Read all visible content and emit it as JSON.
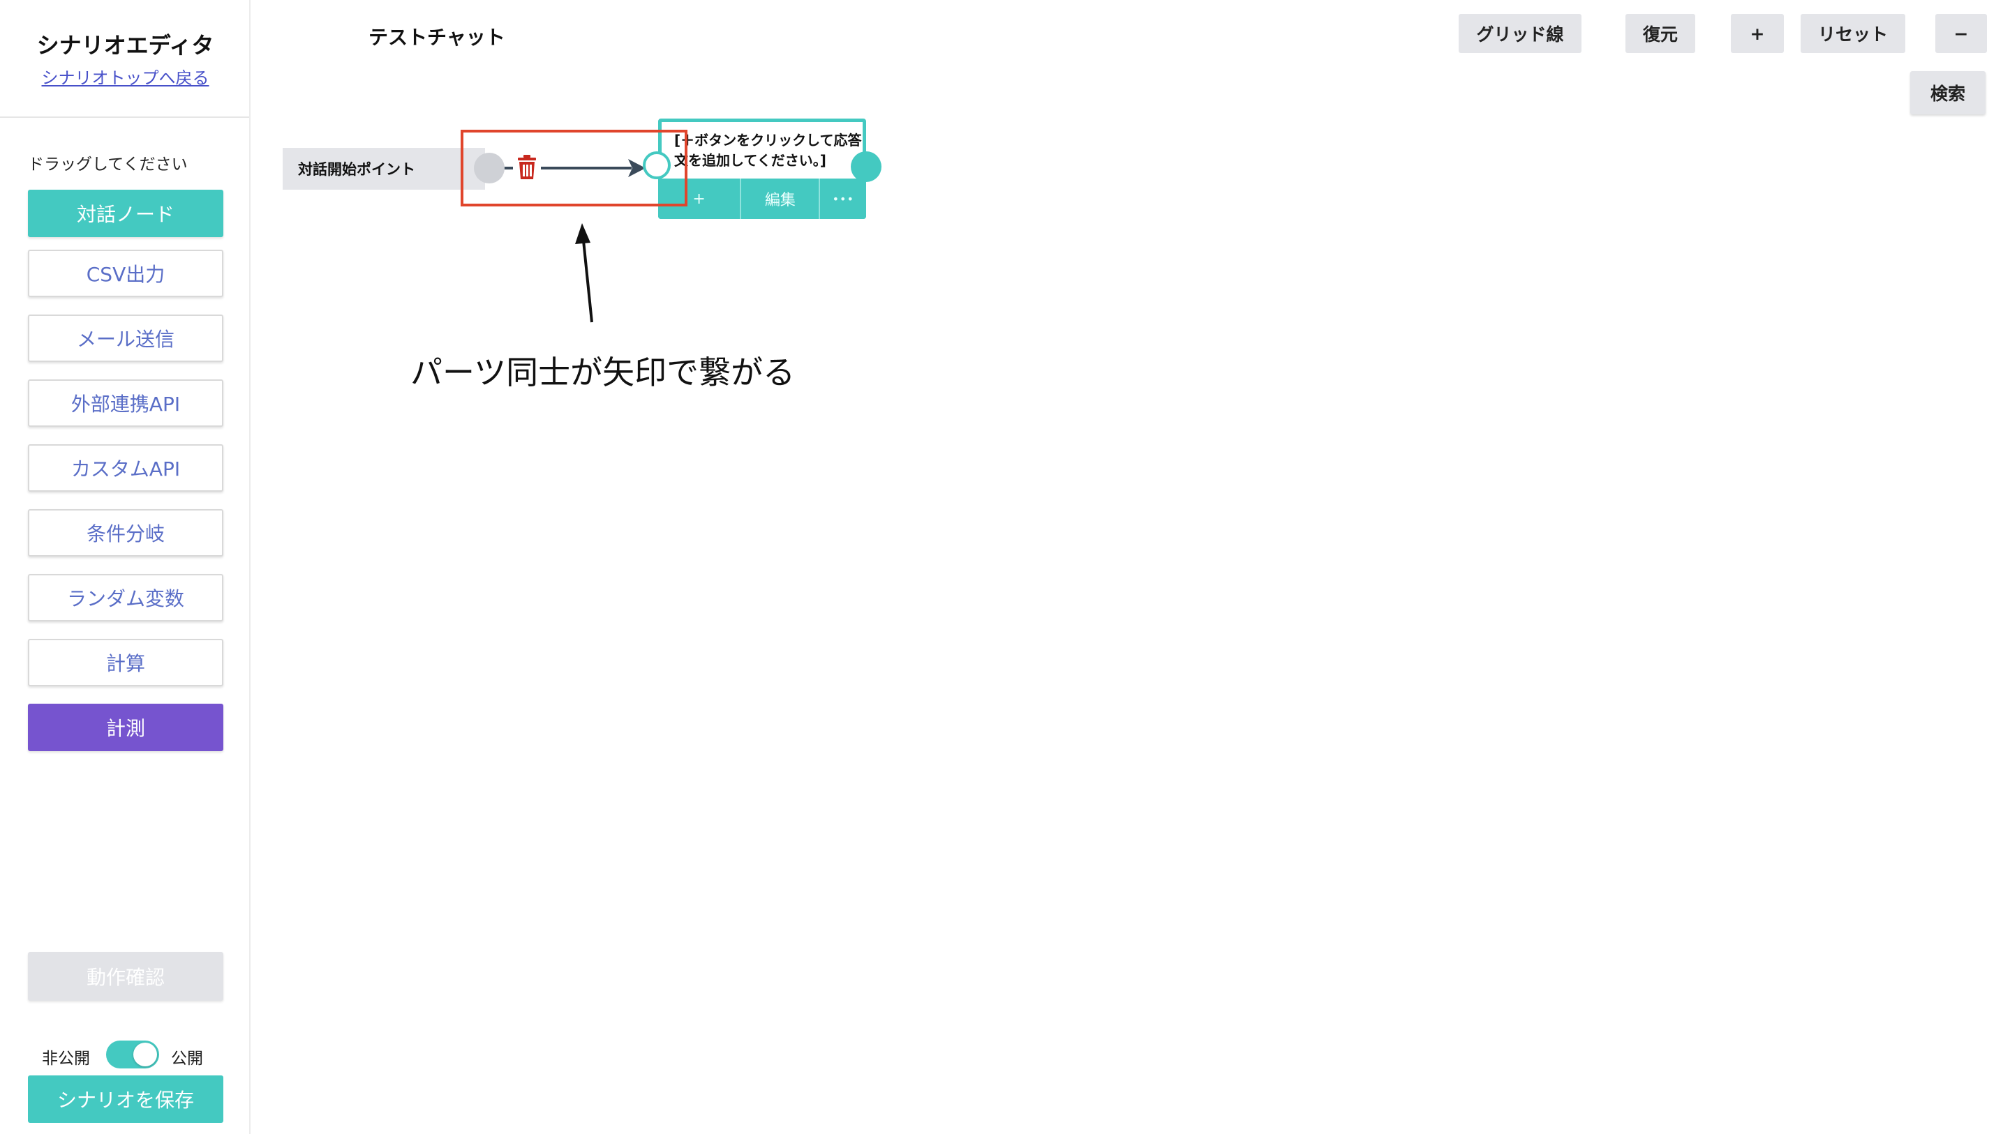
{
  "sidebar": {
    "title": "シナリオエディタ",
    "back_link": "シナリオトップへ戻る",
    "drag_hint": "ドラッグしてください",
    "tools": [
      {
        "label": "対話ノード",
        "style": "teal"
      },
      {
        "label": "CSV出力",
        "style": "outline"
      },
      {
        "label": "メール送信",
        "style": "outline"
      },
      {
        "label": "外部連携API",
        "style": "outline"
      },
      {
        "label": "カスタムAPI",
        "style": "outline"
      },
      {
        "label": "条件分岐",
        "style": "outline"
      },
      {
        "label": "ランダム変数",
        "style": "outline"
      },
      {
        "label": "計算",
        "style": "outline"
      },
      {
        "label": "計測",
        "style": "purple"
      }
    ],
    "verify_label": "動作確認",
    "visibility": {
      "off_label": "非公開",
      "on_label": "公開",
      "is_public": true
    },
    "save_label": "シナリオを保存"
  },
  "header": {
    "scenario_name": "テストチャット",
    "toolbar": {
      "grid_label": "グリッド線",
      "restore_label": "復元",
      "zoom_in_label": "+",
      "reset_label": "リセット",
      "zoom_out_label": "−"
    },
    "search_label": "検索"
  },
  "canvas": {
    "start_node_label": "対話開始ポイント",
    "dialog_node": {
      "text": "[＋ボタンをクリックして応答文を追加してください。]",
      "add_label": "+",
      "edit_label": "編集",
      "more_label": "•••"
    },
    "delete_edge_icon": "trash-icon"
  },
  "annotation": {
    "text": "パーツ同士が矢印で繋がる"
  },
  "colors": {
    "teal": "#44c9c1",
    "purple": "#7654cf",
    "link": "#4750c9",
    "tool_text": "#5a6ec7",
    "highlight": "#e0452c",
    "trash": "#c8281e",
    "button_gray": "#e4e5e9"
  }
}
